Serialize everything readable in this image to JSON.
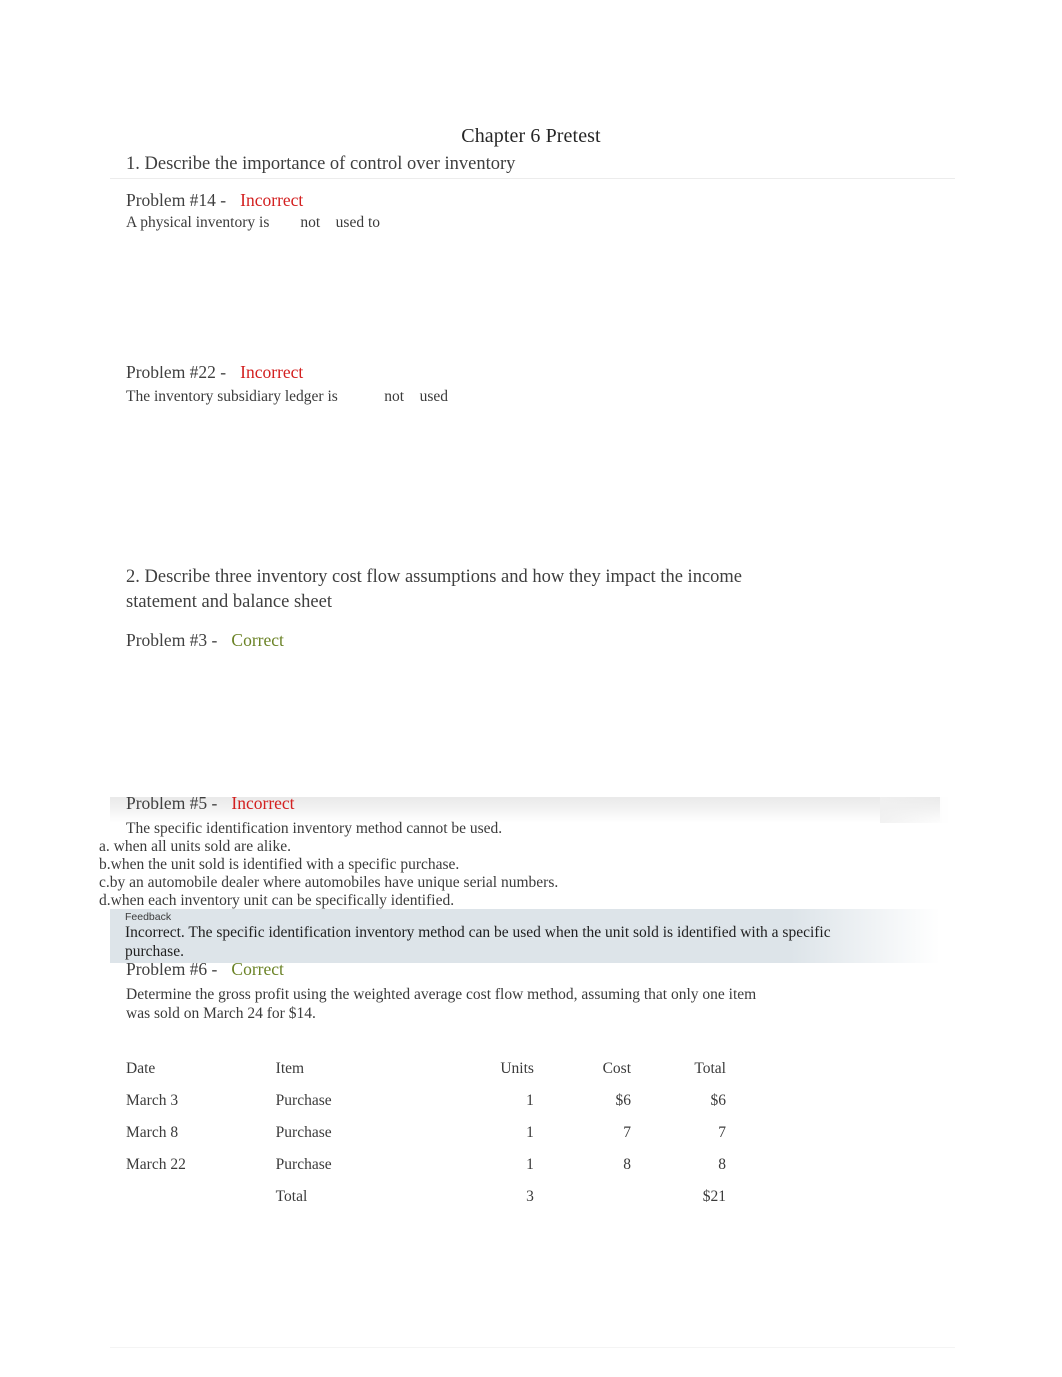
{
  "document": {
    "title": "Chapter 6 Pretest"
  },
  "sections": [
    {
      "heading": "1. Describe the importance of control over inventory",
      "problems": [
        {
          "label": "Problem #14 -",
          "status": "Incorrect",
          "status_type": "incorrect",
          "body": "A physical inventory is        not    used to"
        },
        {
          "label": "Problem #22 -",
          "status": "Incorrect",
          "status_type": "incorrect",
          "body": "The inventory subsidiary ledger is            not    used"
        }
      ]
    },
    {
      "heading": "2. Describe three inventory cost flow assumptions and how they impact the income statement and balance sheet",
      "problems": [
        {
          "label": "Problem #3 -",
          "status": "Correct",
          "status_type": "correct",
          "body": ""
        },
        {
          "label": "Problem #5 -",
          "status": "Incorrect",
          "status_type": "incorrect",
          "body": "The specific identification inventory method cannot be used.",
          "options": [
            "a. when all units sold are alike.",
            "b.when the unit sold is identified with a specific purchase.",
            "c.by an automobile dealer where automobiles have unique serial numbers.",
            "d.when each inventory unit can be specifically identified."
          ],
          "feedback": {
            "label": "Feedback",
            "text": "Incorrect. The specific identification inventory method can be used when the unit sold is identified with a specific purchase."
          }
        },
        {
          "label": "Problem #6 -",
          "status": "Correct",
          "status_type": "correct",
          "body": "Determine the gross profit using the weighted average cost flow method, assuming that only one item was sold on March 24 for $14."
        }
      ]
    }
  ],
  "table": {
    "headers": {
      "date": "Date",
      "item": "Item",
      "units": "Units",
      "cost": "Cost",
      "total": "Total"
    },
    "rows": [
      {
        "date": "March 3",
        "item": "Purchase",
        "units": "1",
        "cost": "$6",
        "total": "$6"
      },
      {
        "date": "March 8",
        "item": "Purchase",
        "units": "1",
        "cost": "7",
        "total": "7"
      },
      {
        "date": "March 22",
        "item": "Purchase",
        "units": "1",
        "cost": "8",
        "total": "8"
      },
      {
        "date": "",
        "item": "Total",
        "units": "3",
        "cost": "",
        "total": "$21"
      }
    ]
  },
  "colors": {
    "incorrect": "#d32020",
    "correct": "#6b8327",
    "feedback_bg": "#dde4e9",
    "text": "#3b3b3b"
  }
}
